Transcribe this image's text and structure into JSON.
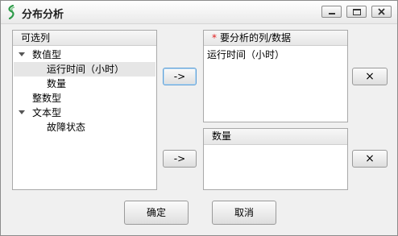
{
  "window": {
    "title": "分布分析"
  },
  "available_panel": {
    "header": "可选列",
    "tree": [
      {
        "label": "数值型"
      },
      {
        "label": "运行时间（小时）"
      },
      {
        "label": "数量"
      },
      {
        "label": "整数型"
      },
      {
        "label": "文本型"
      },
      {
        "label": "故障状态"
      }
    ]
  },
  "target_panel": {
    "required_mark": "*",
    "header": "要分析的列/数据",
    "items": [
      "运行时间（小时）"
    ]
  },
  "group_panel": {
    "header": "数量",
    "items": []
  },
  "buttons": {
    "move_to_target": "->",
    "move_to_group": "->",
    "clear_target": "×",
    "clear_group": "×",
    "ok": "确定",
    "cancel": "取消"
  }
}
